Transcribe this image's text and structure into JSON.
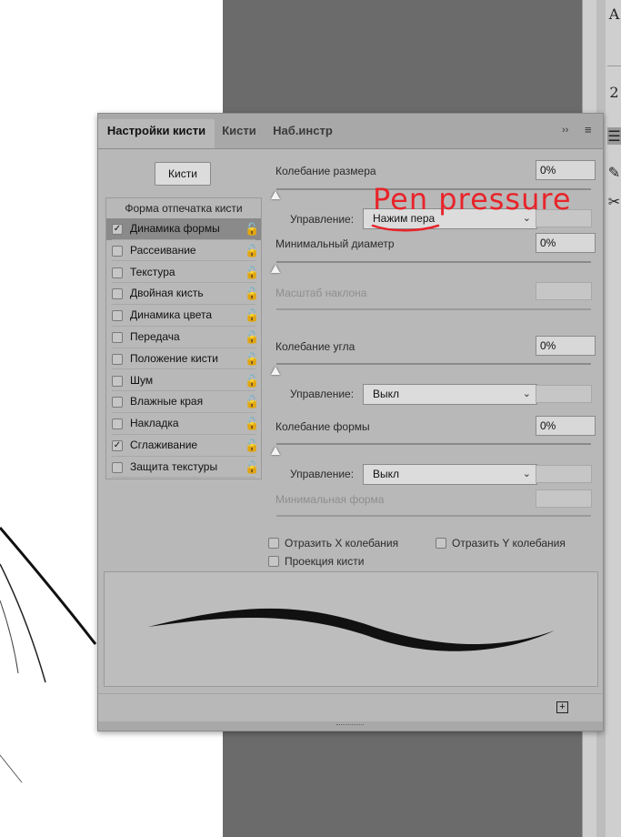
{
  "tabs": [
    {
      "label": "Настройки кисти"
    },
    {
      "label": "Кисти"
    },
    {
      "label": "Наб.инстр"
    }
  ],
  "panel_controls": {
    "collapse": "››",
    "menu": "≡"
  },
  "brushes_button": "Кисти",
  "left_list": {
    "header": "Форма отпечатка кисти",
    "items": [
      {
        "label": "Динамика формы",
        "checked": true,
        "selected": true
      },
      {
        "label": "Рассеивание",
        "checked": false
      },
      {
        "label": "Текстура",
        "checked": false
      },
      {
        "label": "Двойная кисть",
        "checked": false
      },
      {
        "label": "Динамика цвета",
        "checked": false
      },
      {
        "label": "Передача",
        "checked": false
      },
      {
        "label": "Положение кисти",
        "checked": false
      },
      {
        "label": "Шум",
        "checked": false
      },
      {
        "label": "Влажные края",
        "checked": false
      },
      {
        "label": "Накладка",
        "checked": false
      },
      {
        "label": "Сглаживание",
        "checked": true
      },
      {
        "label": "Защита текстуры",
        "checked": false
      }
    ]
  },
  "settings": {
    "size_jitter": {
      "label": "Колебание размера",
      "value": "0%"
    },
    "control1": {
      "label": "Управление:",
      "value": "Нажим пера"
    },
    "min_diameter": {
      "label": "Минимальный диаметр",
      "value": "0%"
    },
    "tilt_scale": {
      "label": "Масштаб наклона"
    },
    "angle_jitter": {
      "label": "Колебание угла",
      "value": "0%"
    },
    "control2": {
      "label": "Управление:",
      "value": "Выкл"
    },
    "roundness_jitter": {
      "label": "Колебание формы",
      "value": "0%"
    },
    "control3": {
      "label": "Управление:",
      "value": "Выкл"
    },
    "min_roundness": {
      "label": "Минимальная форма"
    }
  },
  "options": {
    "flip_x": "Отразить X колебания",
    "flip_y": "Отразить Y колебания",
    "projection": "Проекция кисти"
  },
  "annotation": {
    "text": "Pen pressure",
    "color": "#e8242a"
  },
  "colors": {
    "panel": "#b8b8b8",
    "selected_row": "#8a8a8a",
    "canvas_gray": "#6b6b6b"
  }
}
